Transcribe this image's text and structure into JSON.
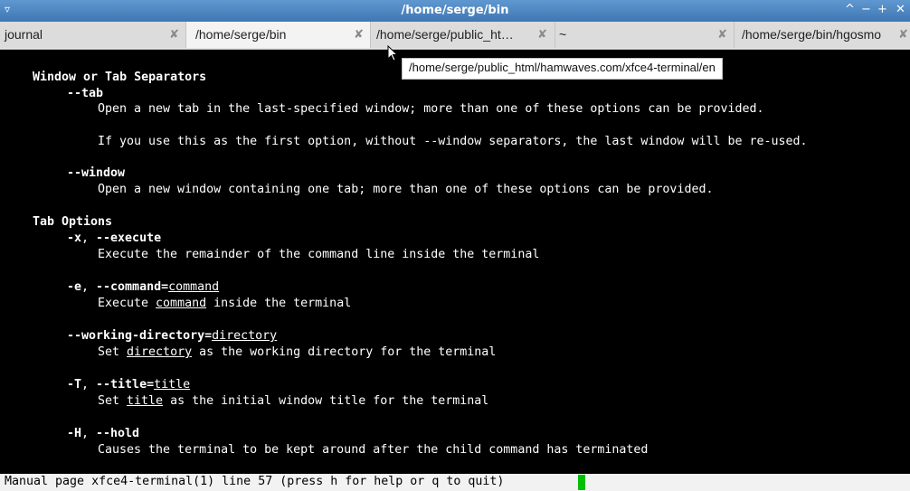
{
  "window": {
    "title": "/home/serge/bin",
    "menu_icon": "menu-icon",
    "controls": {
      "shade": "^",
      "minimize": "−",
      "maximize": "+",
      "close": "✕"
    }
  },
  "tabs": [
    {
      "label": "journal",
      "close": "✘",
      "active": false
    },
    {
      "label": "/home/serge/bin",
      "close": "✘",
      "active": true
    },
    {
      "label": "/home/serge/public_ht…",
      "close": "✘",
      "active": false
    },
    {
      "label": "~",
      "close": "✘",
      "active": false
    },
    {
      "label": "/home/serge/bin/hgosmo",
      "close": "✘",
      "active": false
    }
  ],
  "tooltip": "/home/serge/public_html/hamwaves.com/xfce4-terminal/en",
  "terminal": {
    "sections": [
      {
        "heading": "Window or Tab Separators"
      },
      {
        "heading": "Tab Options"
      }
    ],
    "options": {
      "tab": {
        "flag": "--tab",
        "desc1": "Open a new tab in the last-specified window; more than one of these options can be provided.",
        "desc2": "If you use this as the first option, without --window separators, the last window will be re-used."
      },
      "window": {
        "flag": "--window",
        "desc": "Open a new window containing one tab; more than one of these options can be provided."
      },
      "execute": {
        "flag_short": "-x",
        "sep": ", ",
        "flag_long": "--execute",
        "desc": "Execute the remainder of the command line inside the terminal"
      },
      "command": {
        "flag_short": "-e",
        "sep": ", ",
        "flag_long": "--command=",
        "arg": "command",
        "desc_pre": "Execute ",
        "desc_arg": "command",
        "desc_post": " inside the terminal"
      },
      "workdir": {
        "flag_long": "--working-directory=",
        "arg": "directory",
        "desc_pre": "Set ",
        "desc_arg": "directory",
        "desc_post": " as the working directory for the terminal"
      },
      "title": {
        "flag_short": "-T",
        "sep": ", ",
        "flag_long": "--title=",
        "arg": "title",
        "desc_pre": "Set ",
        "desc_arg": "title",
        "desc_post": " as the initial window title for the terminal"
      },
      "hold": {
        "flag_short": "-H",
        "sep": ", ",
        "flag_long": "--hold",
        "desc": "Causes the terminal to be kept around after the child command has terminated"
      }
    }
  },
  "status_line": "Manual page xfce4-terminal(1) line 57 (press h for help or q to quit)",
  "colors": {
    "titlebar": "#4a84c2",
    "terminal_bg": "#000000",
    "terminal_fg": "#ffffff",
    "cursor": "#00c000"
  }
}
